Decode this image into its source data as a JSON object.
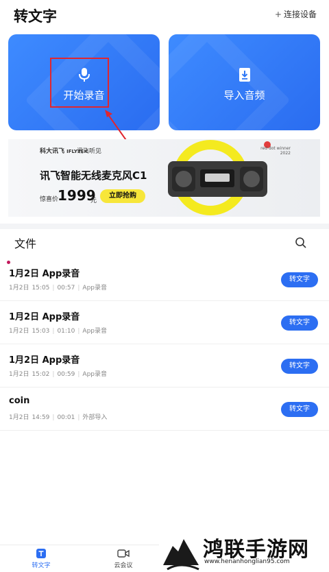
{
  "header": {
    "title": "转文字",
    "connect_label": "连接设备",
    "connect_icon": "plus-icon"
  },
  "actions": {
    "record": {
      "label": "开始录音",
      "icon": "microphone-icon"
    },
    "import": {
      "label": "导入音频",
      "icon": "download-file-icon"
    },
    "color": "#2f78f6"
  },
  "banner": {
    "brand": "科大讯飞",
    "brand_sub": "IFLYTEK",
    "brand2": "讯飞听见",
    "headline": "讯飞智能无线麦克风C1",
    "price_label": "惊喜价",
    "price": "1999",
    "price_unit": "元",
    "buy_label": "立即抢购",
    "award": "red dot winner 2022"
  },
  "files": {
    "title": "文件",
    "search_icon": "search-icon",
    "items": [
      {
        "name": "1月2日 App录音",
        "date": "1月2日",
        "time": "15:05",
        "duration": "00:57",
        "source": "App录音",
        "button": "转文字"
      },
      {
        "name": "1月2日 App录音",
        "date": "1月2日",
        "time": "15:03",
        "duration": "01:10",
        "source": "App录音",
        "button": "转文字"
      },
      {
        "name": "1月2日 App录音",
        "date": "1月2日",
        "time": "15:02",
        "duration": "00:59",
        "source": "App录音",
        "button": "转文字"
      },
      {
        "name": "coin",
        "date": "1月2日",
        "time": "14:59",
        "duration": "00:01",
        "source": "外部导入",
        "button": "转文字"
      }
    ]
  },
  "tabbar": {
    "tabs": [
      {
        "label": "转文字",
        "icon": "transcribe-icon",
        "active": true
      },
      {
        "label": "云会议",
        "icon": "video-camera-icon",
        "active": false
      }
    ]
  },
  "watermark": {
    "text": "鸿联手游网",
    "url": "www.henanhonglian95.com"
  },
  "accent_color": "#2c6ef2",
  "annotation_color": "#e0262f"
}
